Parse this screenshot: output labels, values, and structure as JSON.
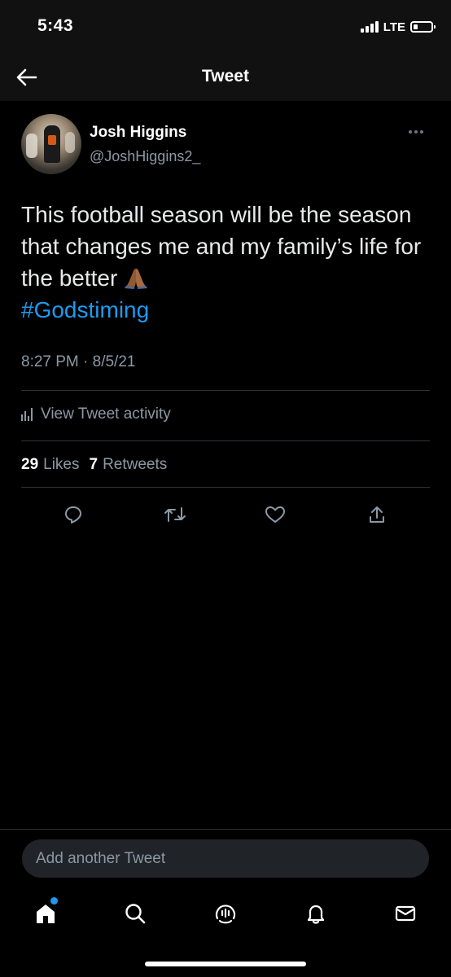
{
  "status_bar": {
    "time": "5:43",
    "network": "LTE"
  },
  "header": {
    "title": "Tweet",
    "back_icon": "arrow-left-icon"
  },
  "tweet": {
    "author": {
      "name": "Josh Higgins",
      "handle": "@JoshHiggins2_"
    },
    "text": "This football season will be the season that changes me and my family’s life for the better ",
    "emoji": "🙏🏾",
    "hashtag": "#Godstiming",
    "timestamp": "8:27 PM · 8/5/21",
    "activity_label": "View Tweet activity",
    "stats": {
      "likes_count": "29",
      "likes_label": "Likes",
      "retweets_count": "7",
      "retweets_label": "Retweets"
    },
    "actions": [
      "reply-icon",
      "retweet-icon",
      "like-icon",
      "share-icon"
    ]
  },
  "compose": {
    "placeholder": "Add another Tweet"
  },
  "tab_bar": {
    "items": [
      "home-icon",
      "search-icon",
      "spaces-icon",
      "notifications-icon",
      "messages-icon"
    ]
  },
  "colors": {
    "background": "#000000",
    "accent": "#1d9bf0",
    "secondary_text": "#8b98a5",
    "divider": "#2f3336"
  }
}
